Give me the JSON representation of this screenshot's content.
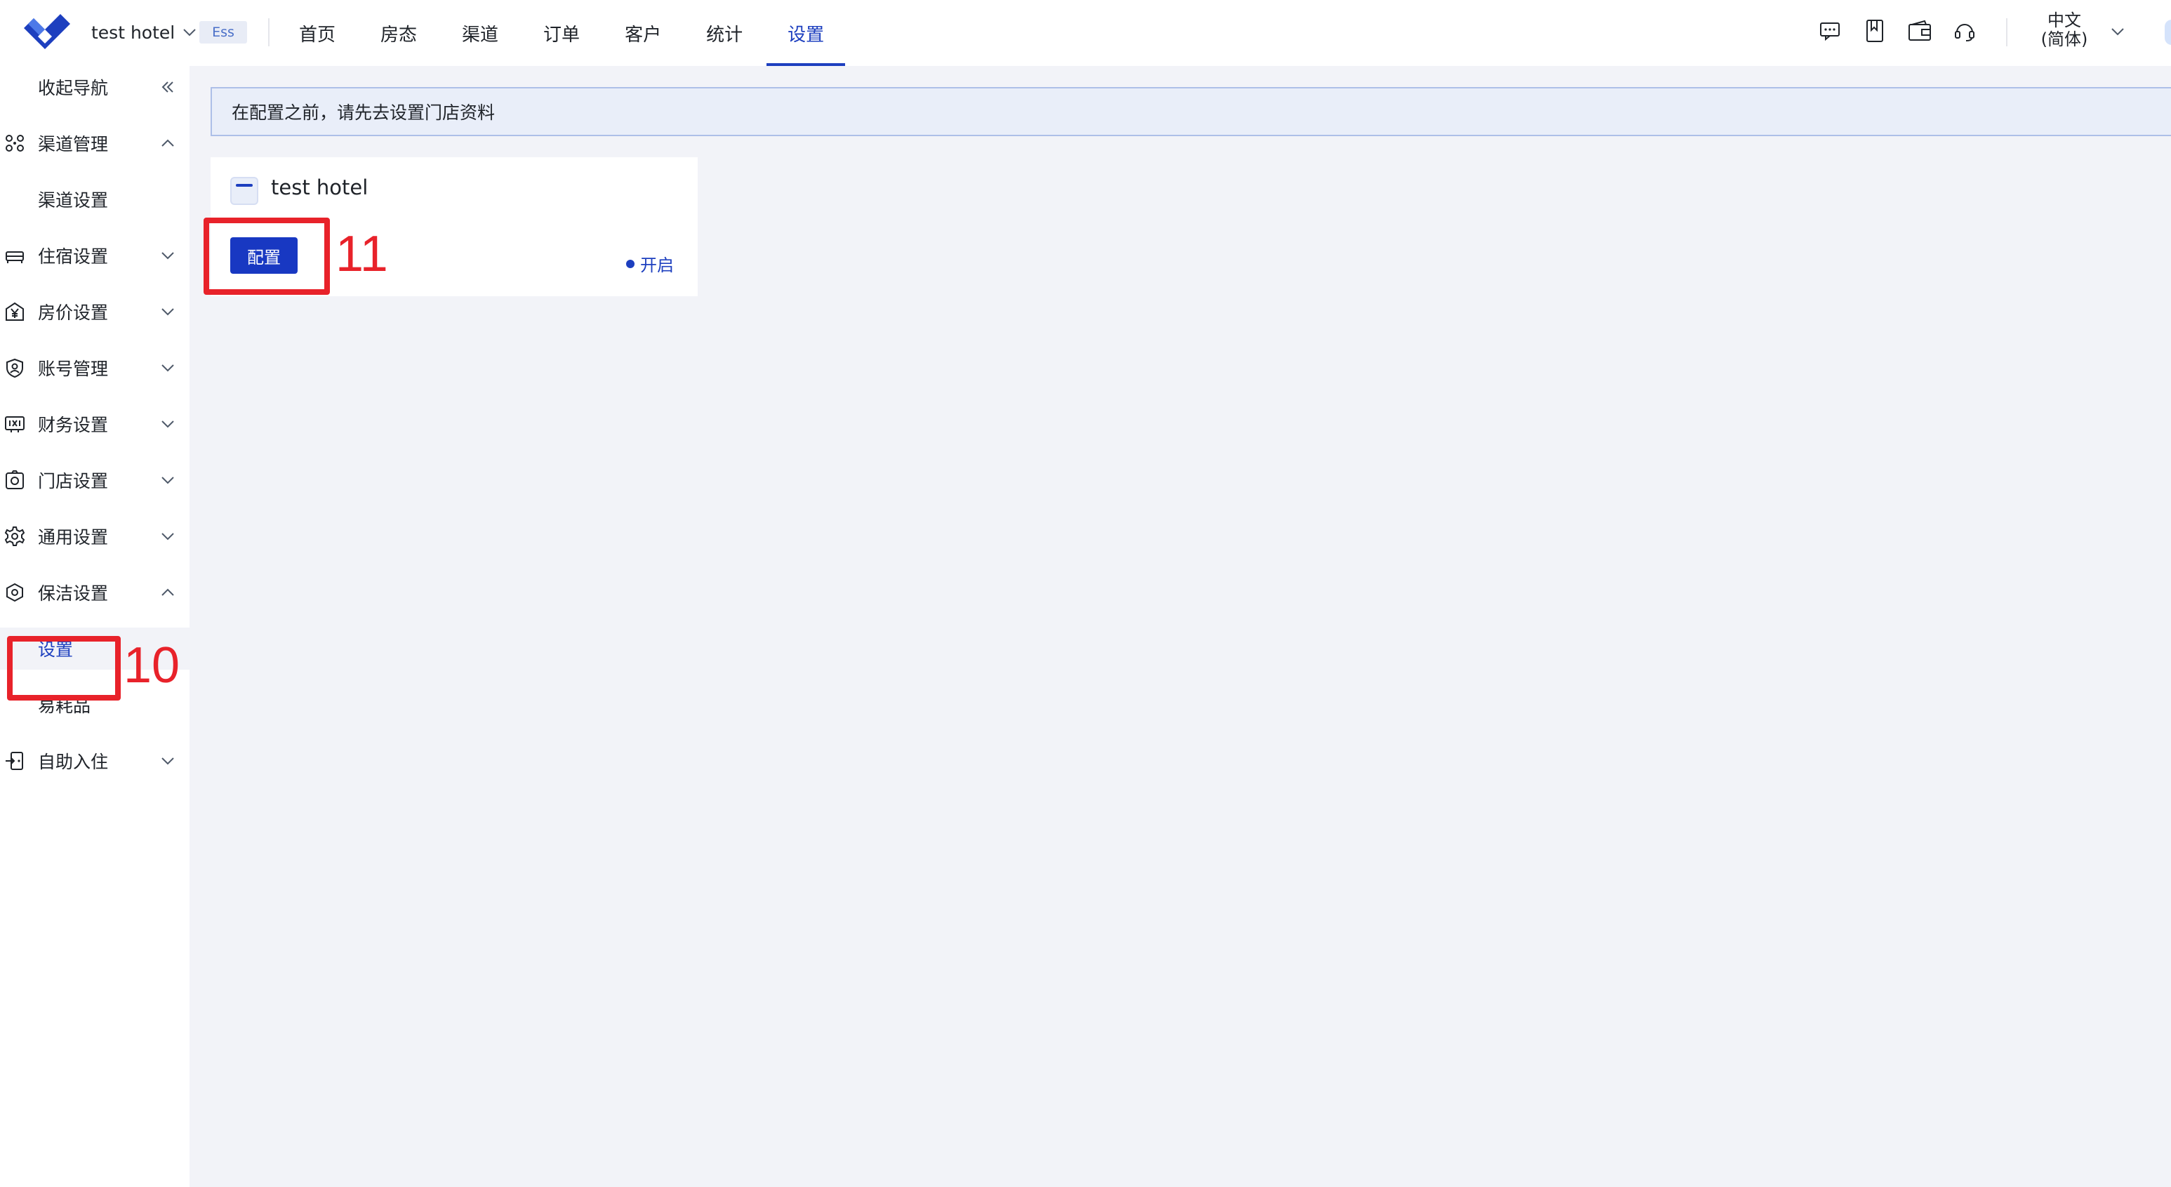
{
  "header": {
    "hotel_name": "test hotel",
    "edition_badge": "Ess",
    "nav": [
      {
        "label": "首页"
      },
      {
        "label": "房态"
      },
      {
        "label": "渠道"
      },
      {
        "label": "订单"
      },
      {
        "label": "客户"
      },
      {
        "label": "统计"
      },
      {
        "label": "设置",
        "active": true
      }
    ],
    "icons": [
      "message-icon",
      "book-icon",
      "wallet-icon",
      "headset-icon"
    ],
    "language_line1": "中文",
    "language_line2": "(简体)"
  },
  "sidebar": {
    "collapse_label": "收起导航",
    "items": [
      {
        "label": "渠道管理",
        "icon": "channel-icon",
        "expanded": true
      },
      {
        "label": "渠道设置",
        "sub": true
      },
      {
        "label": "住宿设置",
        "icon": "bed-icon"
      },
      {
        "label": "房价设置",
        "icon": "yen-icon"
      },
      {
        "label": "账号管理",
        "icon": "user-shield-icon"
      },
      {
        "label": "财务设置",
        "icon": "finance-icon"
      },
      {
        "label": "门店设置",
        "icon": "store-icon"
      },
      {
        "label": "通用设置",
        "icon": "gear-icon"
      },
      {
        "label": "保洁设置",
        "icon": "cleaning-icon",
        "expanded": true
      },
      {
        "label": "设置",
        "sub": true,
        "selected": true
      },
      {
        "label": "易耗品",
        "sub": true
      },
      {
        "label": "自助入住",
        "icon": "self-checkin-icon"
      }
    ]
  },
  "main": {
    "notice": "在配置之前，请先去设置门店资料",
    "card": {
      "title": "test hotel",
      "config_button": "配置",
      "status": "开启"
    }
  },
  "annotations": {
    "sidebar_marker": "10",
    "button_marker": "11",
    "color": "#e8222a"
  },
  "colors": {
    "accent": "#1d3fbf",
    "button": "#1838c2",
    "background": "#f2f3f8"
  }
}
